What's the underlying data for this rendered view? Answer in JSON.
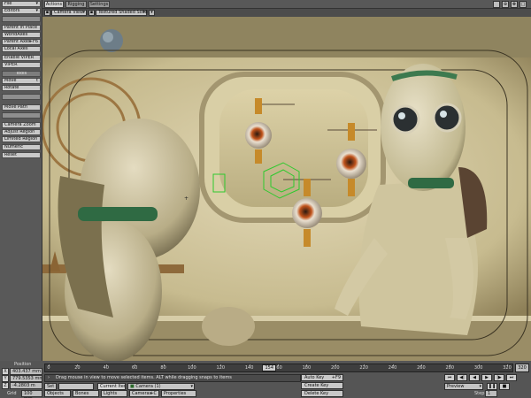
{
  "toolbar": {
    "items": [
      {
        "label": "File",
        "type": "drop"
      },
      {
        "label": "Editors",
        "type": "drop"
      },
      {
        "label": "Parent in Place",
        "type": "button"
      },
      {
        "label": "WorldAxes",
        "type": "button"
      },
      {
        "label": "Parent Axes",
        "type": "button",
        "key": "+F6"
      },
      {
        "label": "Local Axes",
        "type": "button"
      },
      {
        "label": "Enable VIPER",
        "type": "button"
      },
      {
        "label": "VIPER",
        "type": "button"
      },
      {
        "label": "Tools",
        "type": "header"
      },
      {
        "label": "Move",
        "type": "button",
        "key": "t"
      },
      {
        "label": "Rotate",
        "type": "button"
      },
      {
        "label": "Move Path",
        "type": "button"
      },
      {
        "label": "Camera Zoom",
        "type": "button"
      },
      {
        "label": "Adjust Region",
        "type": "button"
      },
      {
        "label": "Limited Region",
        "type": "button"
      },
      {
        "label": "Numeric",
        "type": "button"
      },
      {
        "label": "Reset",
        "type": "button"
      }
    ]
  },
  "tabs": [
    {
      "label": "Actions",
      "active": true
    },
    {
      "label": "Rigging",
      "active": false
    },
    {
      "label": "Settings",
      "active": false
    }
  ],
  "viewport_header": {
    "view": "Camera View",
    "shading": "Textured Shaded Solid"
  },
  "position_panel": {
    "label": "Position",
    "axes": [
      {
        "axis": "X",
        "value": "403.437 mm"
      },
      {
        "axis": "Y",
        "value": "779.5353 mm"
      },
      {
        "axis": "Z",
        "value": "-4.2803 m"
      }
    ],
    "grid_label": "Grid",
    "grid_value": "100 mm"
  },
  "timeline": {
    "ticks": [
      "0",
      "20",
      "40",
      "60",
      "80",
      "100",
      "120",
      "140",
      "160",
      "180",
      "200",
      "220",
      "240",
      "260",
      "280",
      "300",
      "320"
    ],
    "current_frame": "154",
    "end_frame": "320"
  },
  "status": {
    "message": "Drag mouse in view to move selected items. ALT while dragging snaps to items"
  },
  "controls": {
    "set_label": "Set",
    "current_item_label": "Current Item",
    "current_item_value": "Camera (1)",
    "objects": "Objects",
    "bones": "Bones",
    "lights": "Lights",
    "cameras": "Cameras",
    "cameras_key": "+C",
    "properties": "Properties",
    "auto_key": "Auto Key",
    "auto_key_shortcut": "+F9",
    "create_key": "Create Key",
    "delete_key": "Delete Key",
    "preview": "Preview",
    "step_label": "Step",
    "step_value": "1"
  },
  "transport_icons": [
    "skip-start-icon",
    "step-back-icon",
    "play-reverse-icon",
    "play-icon",
    "step-forward-icon",
    "skip-end-icon",
    "pause-icon",
    "stop-icon"
  ],
  "colors": {
    "toolbar_bg": "#595959",
    "button_bg": "#c9c9c9",
    "timeline_bg": "#3e3e3e",
    "scene_wall": "#c7bb8f"
  }
}
